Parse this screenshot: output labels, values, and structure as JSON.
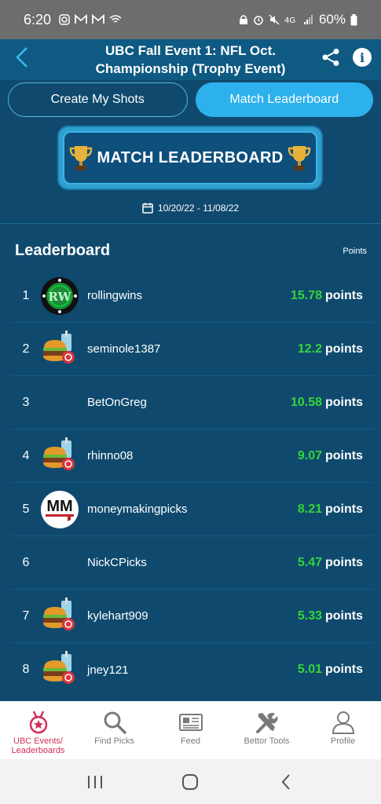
{
  "status_bar": {
    "time": "6:20",
    "battery": "60%"
  },
  "header": {
    "title": "UBC Fall Event 1: NFL Oct. Championship (Trophy Event)"
  },
  "tabs": [
    {
      "label": "Create My Shots",
      "active": false
    },
    {
      "label": "Match Leaderboard",
      "active": true
    }
  ],
  "banner": {
    "text": "MATCH LEADERBOARD"
  },
  "date_range": "10/20/22 - 11/08/22",
  "leaderboard": {
    "title": "Leaderboard",
    "points_label": "Points",
    "unit": "points",
    "rows": [
      {
        "rank": "1",
        "username": "rollingwins",
        "points": "15.78",
        "avatar": "rw-logo"
      },
      {
        "rank": "2",
        "username": "seminole1387",
        "points": "12.2",
        "avatar": "burger-soda"
      },
      {
        "rank": "3",
        "username": "BetOnGreg",
        "points": "10.58",
        "avatar": "none"
      },
      {
        "rank": "4",
        "username": "rhinno08",
        "points": "9.07",
        "avatar": "burger-soda"
      },
      {
        "rank": "5",
        "username": "moneymakingpicks",
        "points": "8.21",
        "avatar": "mm-logo"
      },
      {
        "rank": "6",
        "username": "NickCPicks",
        "points": "5.47",
        "avatar": "none"
      },
      {
        "rank": "7",
        "username": "kylehart909",
        "points": "5.33",
        "avatar": "burger-soda"
      },
      {
        "rank": "8",
        "username": "jney121",
        "points": "5.01",
        "avatar": "burger-soda"
      }
    ]
  },
  "bottom_nav": [
    {
      "label": "UBC Events/ Leaderboards",
      "icon": "medal-icon",
      "active": true
    },
    {
      "label": "Find Picks",
      "icon": "search-icon",
      "active": false
    },
    {
      "label": "Feed",
      "icon": "newspaper-icon",
      "active": false
    },
    {
      "label": "Bettor Tools",
      "icon": "tools-icon",
      "active": false
    },
    {
      "label": "Profile",
      "icon": "person-icon",
      "active": false
    }
  ],
  "colors": {
    "background": "#0f4a6e",
    "accent": "#2db1ec",
    "points_green": "#34d43a",
    "active_nav": "#d32f5a"
  }
}
